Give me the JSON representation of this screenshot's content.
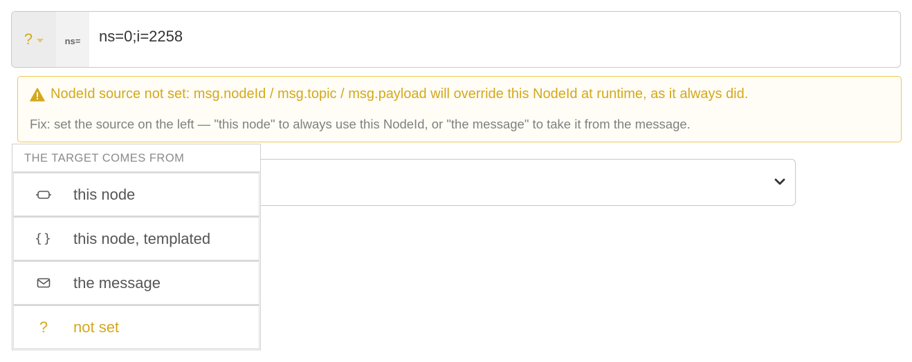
{
  "nodeid_input": {
    "source_glyph": "?",
    "source_icon": "caret-down-icon",
    "ns_prefix": "ns=",
    "value": "ns=0;i=2258"
  },
  "warning": {
    "icon": "warning-triangle-icon",
    "message": "NodeId source not set: msg.nodeId / msg.topic / msg.payload will override this NodeId at runtime, as it always did.",
    "fix": "Fix: set the source on the left — \"this node\" to always use this NodeId, or \"the message\" to take it from the message.",
    "color": "#d4a81c"
  },
  "select": {
    "value": "",
    "icon": "chevron-down-icon"
  },
  "source_menu": {
    "header": "THE TARGET COMES FROM",
    "items": [
      {
        "icon": "node-box-icon",
        "glyph": "",
        "label": "this node"
      },
      {
        "icon": "braces-icon",
        "glyph": "{}",
        "label": "this node, templated"
      },
      {
        "icon": "envelope-icon",
        "glyph": "",
        "label": "the message"
      },
      {
        "icon": "question-icon",
        "glyph": "?",
        "label": "not set",
        "active": true
      }
    ]
  }
}
